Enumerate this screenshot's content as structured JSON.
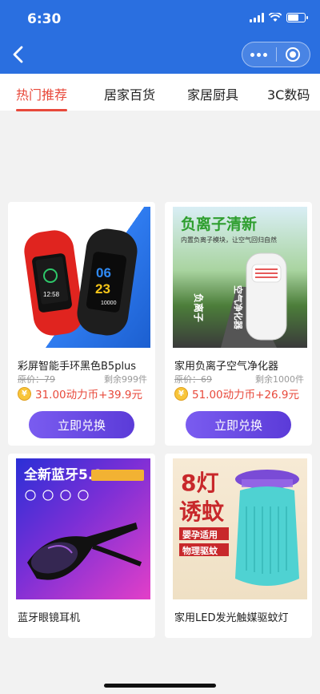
{
  "status_bar": {
    "time": "6:30"
  },
  "nav": {
    "back_icon": "chevron-left-icon",
    "menu_icon": "more-dots-icon",
    "close_icon": "target-circle-icon"
  },
  "tabs": [
    {
      "label": "热门推荐",
      "active": true
    },
    {
      "label": "居家百货",
      "active": false
    },
    {
      "label": "家居厨具",
      "active": false
    },
    {
      "label": "3C数码",
      "active": false
    }
  ],
  "products": [
    {
      "title": "彩屏智能手环黑色B5plus",
      "original_price": "原价：79",
      "stock": "剩余999件",
      "exchange": "31.00动力币+39.9元",
      "button": "立即兑换",
      "image": {
        "screen_left": "12:58",
        "screen_right": "23",
        "steps": "10000"
      }
    },
    {
      "title": "家用负离子空气净化器",
      "original_price": "原价：69",
      "stock": "剩余1000件",
      "exchange": "51.00动力币+26.9元",
      "button": "立即兑换",
      "image": {
        "headline": "负离子清新",
        "sub": "内置负离子模块，让空气回归自然",
        "side_left": "负离子",
        "side_right": "空气净化器"
      }
    },
    {
      "title": "蓝牙眼镜耳机",
      "image": {
        "headline": "全新蓝牙5.0"
      }
    },
    {
      "title": "家用LED发光触媒驱蚊灯",
      "image": {
        "headline_1": "8灯",
        "headline_2": "诱蚊",
        "sub_1": "婴孕适用",
        "sub_2": "物理驱蚊"
      }
    }
  ],
  "coin_symbol": "¥"
}
